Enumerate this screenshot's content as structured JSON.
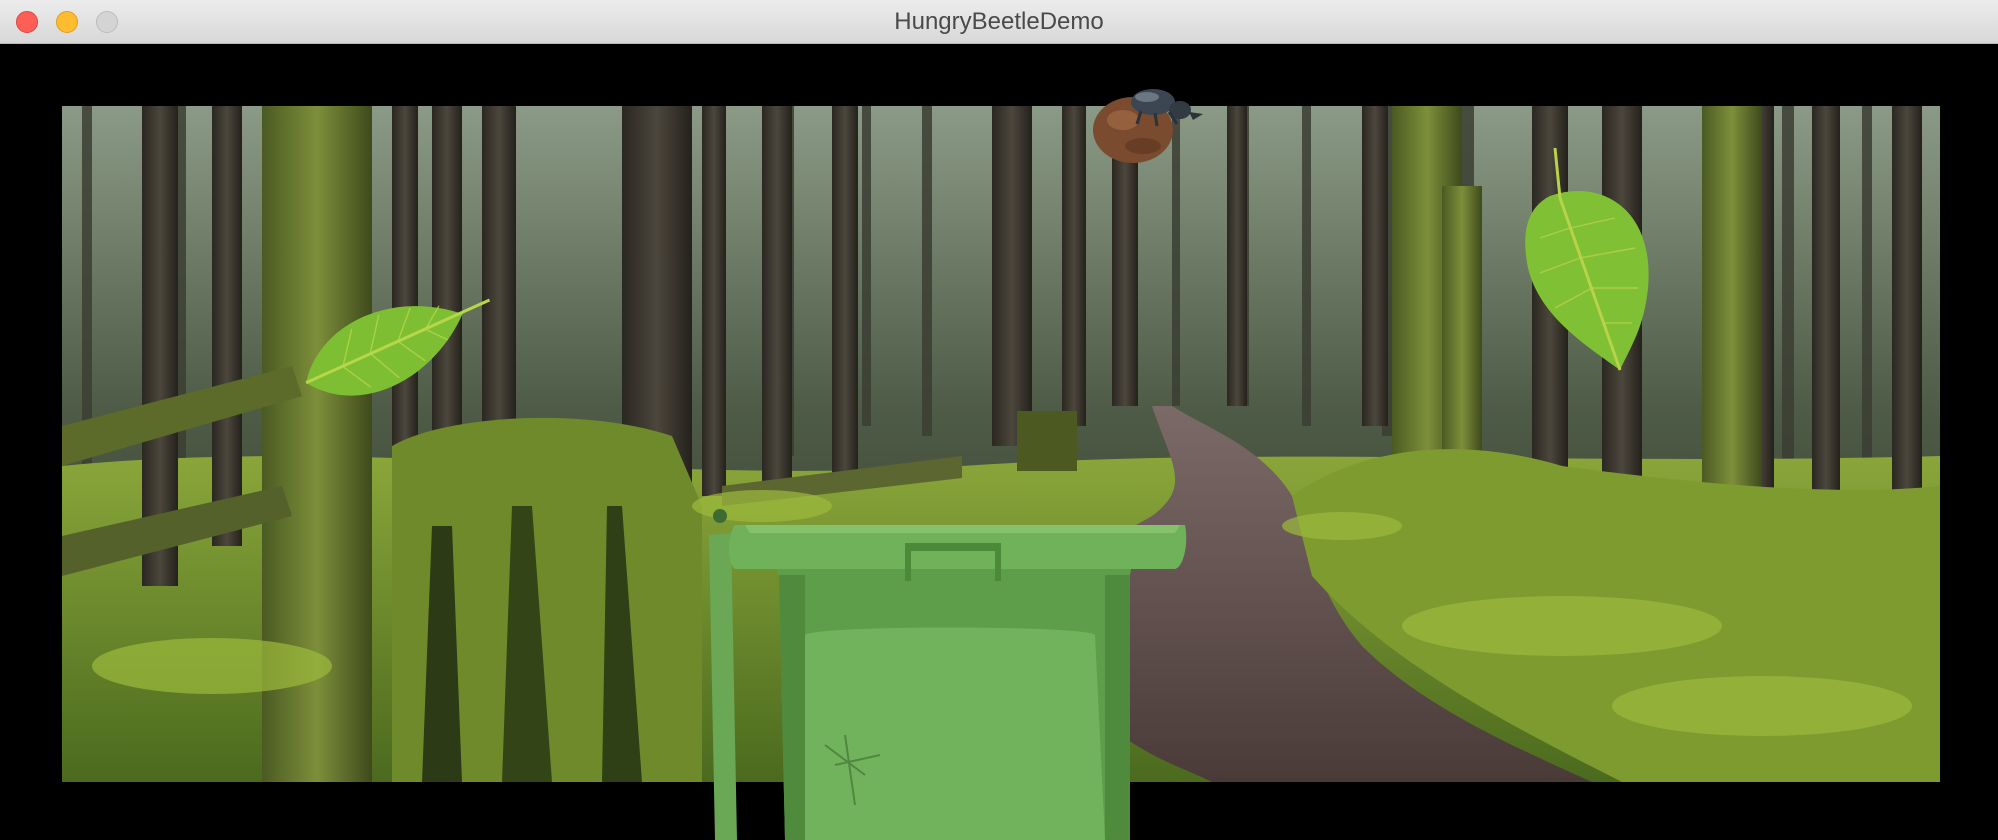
{
  "window": {
    "title": "HungryBeetleDemo",
    "buttons": [
      "close",
      "minimize",
      "zoom"
    ]
  },
  "scene": {
    "background": "forest-trail",
    "sprites": [
      {
        "name": "beetle-with-seed",
        "icon": "beetle-icon"
      },
      {
        "name": "leaf",
        "icon": "leaf-icon"
      },
      {
        "name": "leaf",
        "icon": "leaf-icon"
      },
      {
        "name": "compost-bin",
        "icon": "bin-icon"
      }
    ]
  },
  "colors": {
    "close": "#fd5f57",
    "minimize": "#febc2e",
    "zoom": "#d4d4d4",
    "moss": "#6a8d2c",
    "bin": "#5e9e4a",
    "leaf": "#7ec32e",
    "trail": "#5a4642"
  }
}
